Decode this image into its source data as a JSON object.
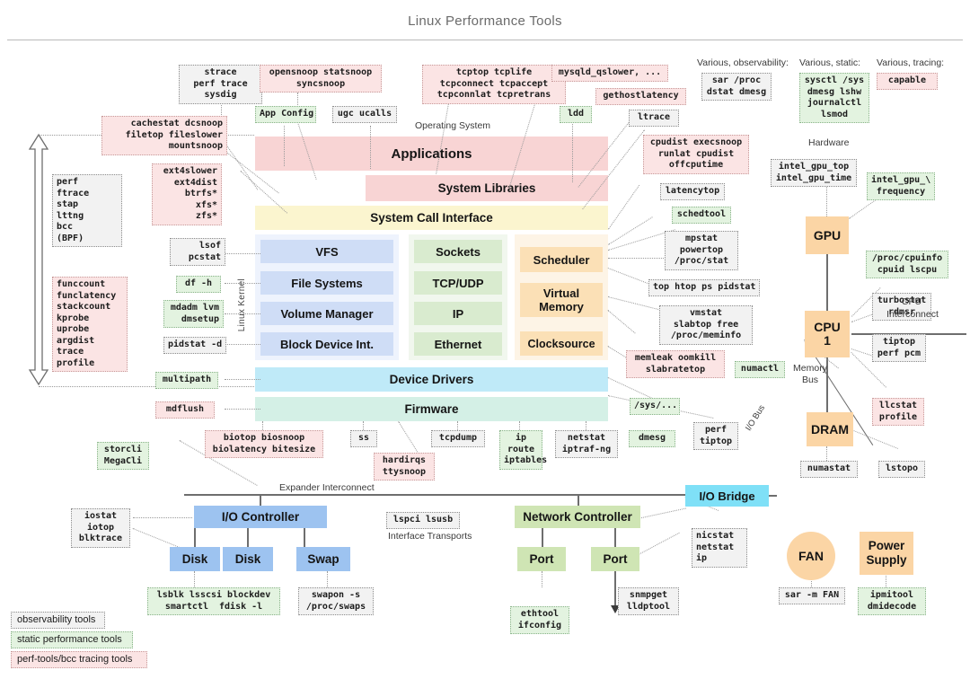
{
  "page": {
    "title": "Linux Performance Tools"
  },
  "captions": {
    "operating_system": "Operating System",
    "hardware": "Hardware",
    "linux_kernel": "Linux Kernel",
    "various_observability": "Various, observability:",
    "various_static": "Various, static:",
    "various_tracing": "Various, tracing:",
    "cpu_interconnect_1": "CPU",
    "cpu_interconnect_2": "Interconnect",
    "memory_bus_1": "Memory",
    "memory_bus_2": "Bus",
    "io_bus": "I/O Bus",
    "expander_interconnect": "Expander Interconnect",
    "interface_transports": "Interface Transports"
  },
  "stack": {
    "applications": "Applications",
    "system_libraries": "System Libraries",
    "system_call_interface": "System Call Interface",
    "vfs": "VFS",
    "file_systems": "File Systems",
    "volume_manager": "Volume Manager",
    "block_device_int": "Block Device Int.",
    "sockets": "Sockets",
    "tcp_udp": "TCP/UDP",
    "ip": "IP",
    "ethernet": "Ethernet",
    "scheduler": "Scheduler",
    "virtual_memory": "Virtual\nMemory",
    "clocksource": "Clocksource",
    "device_drivers": "Device Drivers",
    "firmware": "Firmware"
  },
  "hardware": {
    "gpu": "GPU",
    "cpu": "CPU\n1",
    "dram": "DRAM",
    "io_bridge": "I/O Bridge",
    "io_controller": "I/O Controller",
    "disk_1": "Disk",
    "disk_2": "Disk",
    "swap": "Swap",
    "network_controller": "Network Controller",
    "port_1": "Port",
    "port_2": "Port",
    "fan": "FAN",
    "power_supply": "Power\nSupply"
  },
  "tools": {
    "strace": "strace\nperf trace\nsysdig",
    "opensnoop": "opensnoop statsnoop\nsyncsnoop",
    "tcptop": "tcptop tcplife\ntcpconnect tcpaccept\ntcpconnlat tcpretrans",
    "mysqld_qslower": "mysqld_qslower, ...",
    "gethostlatency": "gethostlatency",
    "app_config": "App Config",
    "ugc_ucalls": "ugc ucalls",
    "ldd": "ldd",
    "ltrace": "ltrace",
    "cachestat": "cachestat dcsnoop\nfiletop fileslower\nmountsnoop",
    "cpudist": "cpudist execsnoop\nrunlat cpudist\noffcputime",
    "latencytop": "latencytop",
    "schedtool": "schedtool",
    "mpstat": "mpstat\npowertop\n/proc/stat",
    "top_htop": "top htop ps pidstat",
    "vmstat": "vmstat\nslabtop free\n/proc/meminfo",
    "memleak": "memleak oomkill\nslabratetop",
    "sys_slash": "/sys/...",
    "perf_tiptop": "perf\ntiptop",
    "dmesg_box": "dmesg",
    "perf_group": "perf\nftrace\nstap\nlttng\nbcc\n(BPF)",
    "funccount": "funccount\nfunclatency\nstackcount\nkprobe\nuprobe\nargdist\ntrace\nprofile",
    "ext4slower": "ext4slower\next4dist\nbtrfs*\nxfs*\nzfs*",
    "lsof": "lsof\npcstat",
    "df_h": "df -h",
    "mdadm": "mdadm lvm\ndmsetup",
    "pidstat_d": "pidstat -d",
    "multipath": "multipath",
    "mdflush": "mdflush",
    "storcli": "storcli\nMegaCli",
    "iostat": "iostat\niotop\nblktrace",
    "biotop": "biotop biosnoop\nbiolatency bitesize",
    "ss": "ss",
    "hardirqs": "hardirqs\nttysnoop",
    "tcpdump": "tcpdump",
    "ip_route": "ip\nroute\niptables",
    "netstat_iptraf": "netstat\niptraf-ng",
    "dmesg_right": "dmesg",
    "sar_proc": "sar /proc\ndstat dmesg",
    "sysctl": "sysctl /sys\ndmesg lshw\njournalctl\nlsmod",
    "capable": "capable",
    "intel_gpu_top": "intel_gpu_top\nintel_gpu_time",
    "intel_gpu_freq": "intel_gpu_\\\nfrequency",
    "proc_cpuinfo": "/proc/cpuinfo\ncpuid lscpu",
    "turbostat": "turbostat\nrdmsr",
    "tiptop_perf_pcm": "tiptop\nperf pcm",
    "llcstat": "llcstat\nprofile",
    "numactl": "numactl",
    "numastat": "numastat",
    "lstopo": "lstopo",
    "lspci": "lspci lsusb",
    "lsblk": "lsblk lsscsi blockdev\nsmartctl  fdisk -l",
    "swapon": "swapon -s\n/proc/swaps",
    "ethtool": "ethtool\nifconfig",
    "snmpget": "snmpget\nlldptool",
    "nicstat": "nicstat\nnetstat\nip",
    "sar_fan": "sar -m FAN",
    "ipmitool": "ipmitool\ndmidecode"
  },
  "legend": {
    "observability": "observability tools",
    "static": "static performance tools",
    "tracing": "perf-tools/bcc tracing tools"
  },
  "colors": {
    "observability_bg": "#f2f2f2",
    "static_bg": "#e3f3e0",
    "tracing_bg": "#fbe4e4",
    "applications": "#f8d4d4",
    "syscall": "#fbf5cf",
    "kernel_blue": "#cfddf6",
    "kernel_green": "#d9ebcf",
    "kernel_orange": "#fbe0b6",
    "device_drivers": "#bfeaf8",
    "firmware": "#d4f0e6",
    "hw_orange": "#fbd5a5",
    "hw_blue": "#9dc3f0",
    "hw_cyan": "#7fe0f7",
    "hw_green": "#cfe5b4"
  }
}
